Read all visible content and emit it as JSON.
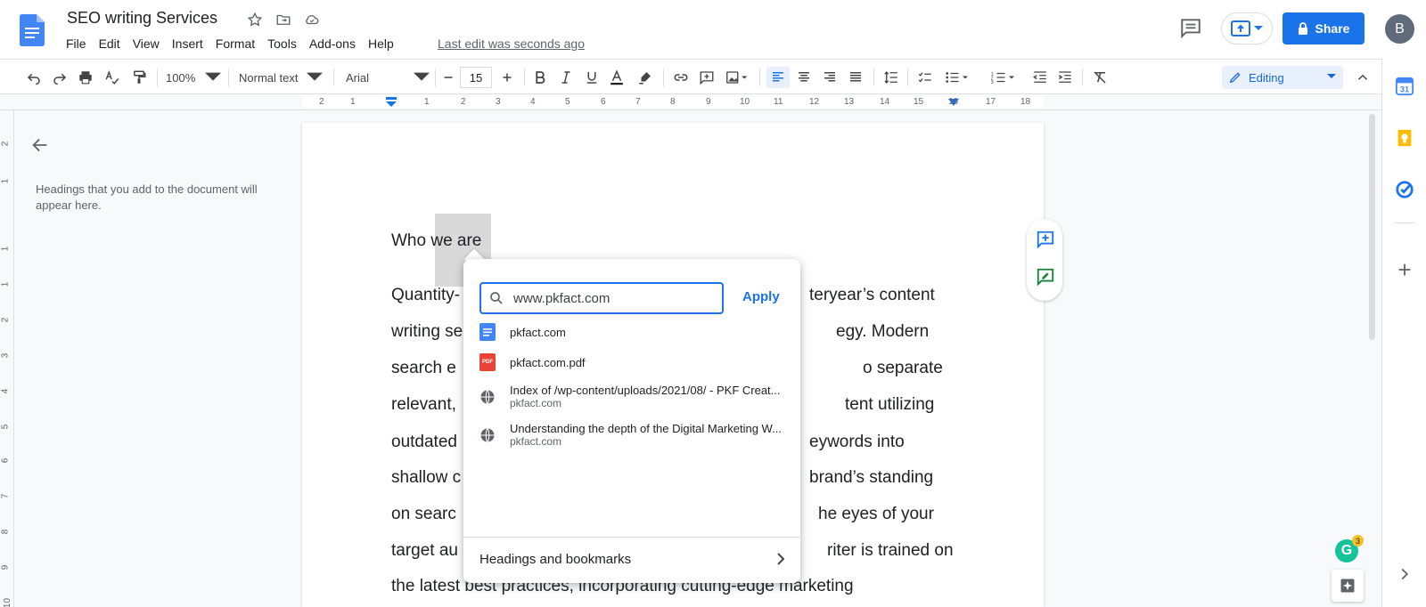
{
  "doc": {
    "title": "SEO writing Services",
    "last_edit": "Last edit was seconds ago"
  },
  "menu": [
    "File",
    "Edit",
    "View",
    "Insert",
    "Format",
    "Tools",
    "Add-ons",
    "Help"
  ],
  "header": {
    "share_label": "Share",
    "avatar_initial": "B"
  },
  "toolbar": {
    "zoom": "100%",
    "style": "Normal text",
    "font": "Arial",
    "font_size": "15",
    "mode": "Editing"
  },
  "ruler": {
    "numbers": [
      "2",
      "1",
      "1",
      "2",
      "3",
      "4",
      "5",
      "6",
      "7",
      "8",
      "9",
      "10",
      "11",
      "12",
      "13",
      "14",
      "15",
      "16",
      "17",
      "18"
    ],
    "vertical_numbers": [
      "2",
      "1",
      "1",
      "1",
      "2",
      "3",
      "4",
      "5",
      "6",
      "7",
      "8",
      "9",
      "10",
      "11"
    ]
  },
  "outline": {
    "hint": "Headings that you add to the document will appear here."
  },
  "document": {
    "heading": "Who we are",
    "lines_left": [
      "Quantity-",
      "writing se",
      "search e",
      "relevant,",
      "outdated",
      "shallow c",
      "on searc",
      "target au",
      "the latest best practices, incorporating cutting-edge marketing"
    ],
    "lines_right": [
      "teryear’s content",
      "egy. Modern",
      "o separate",
      "tent utilizing",
      "eywords into",
      "brand’s standing",
      "he eyes of your",
      "riter is trained on"
    ]
  },
  "link_popup": {
    "search_value": "www.pkfact.com",
    "apply_label": "Apply",
    "suggestions": [
      {
        "title": "pkfact.com",
        "sub": "",
        "icon": "doc-icon"
      },
      {
        "title": "pkfact.com.pdf",
        "sub": "",
        "icon": "pdf-icon"
      },
      {
        "title": "Index of /wp-content/uploads/2021/08/ - PKF Creat...",
        "sub": "pkfact.com",
        "icon": "globe-icon"
      },
      {
        "title": "Understanding the depth of the Digital Marketing W...",
        "sub": "pkfact.com",
        "icon": "globe-icon"
      }
    ],
    "pdf_badge": "PDF",
    "headings_label": "Headings and bookmarks"
  },
  "grammarly": {
    "letter": "G",
    "count": "3"
  },
  "colors": {
    "accent": "#1a73e8",
    "calendar": "#4285f4",
    "keep": "#fbbc04",
    "tasks": "#1a73e8",
    "grammarly": "#15c39a"
  }
}
